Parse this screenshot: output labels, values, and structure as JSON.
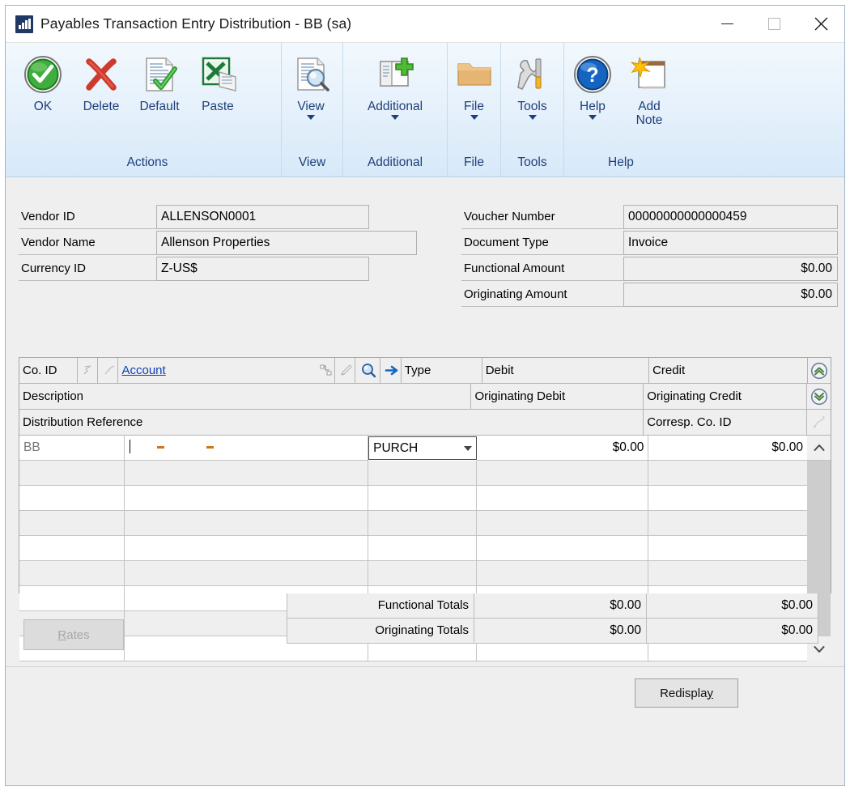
{
  "window": {
    "title": "Payables Transaction Entry Distribution  -  BB (sa)",
    "icon": "barchart-icon",
    "minimize_label": "Minimize",
    "maximize_label": "Maximize",
    "close_label": "Close"
  },
  "ribbon": {
    "groups": [
      {
        "name": "Actions",
        "label": "Actions",
        "buttons": [
          {
            "label": "OK",
            "icon": "green-check-circle-icon",
            "caret": false
          },
          {
            "label": "Delete",
            "icon": "red-x-icon",
            "caret": false
          },
          {
            "label": "Default",
            "icon": "document-check-icon",
            "caret": false
          },
          {
            "label": "Paste",
            "icon": "excel-paste-icon",
            "caret": false
          }
        ]
      },
      {
        "name": "View",
        "label": "View",
        "buttons": [
          {
            "label": "View",
            "icon": "document-magnifier-icon",
            "caret": true
          }
        ]
      },
      {
        "name": "Additional",
        "label": "Additional",
        "buttons": [
          {
            "label": "Additional",
            "icon": "window-plus-icon",
            "caret": true
          }
        ]
      },
      {
        "name": "File",
        "label": "File",
        "buttons": [
          {
            "label": "File",
            "icon": "folder-icon",
            "caret": true
          }
        ]
      },
      {
        "name": "Tools",
        "label": "Tools",
        "buttons": [
          {
            "label": "Tools",
            "icon": "wrench-screwdriver-icon",
            "caret": true
          }
        ]
      },
      {
        "name": "Help",
        "label": "Help",
        "buttons": [
          {
            "label": "Help",
            "icon": "blue-question-circle-icon",
            "caret": true
          },
          {
            "label": "Add\nNote",
            "label_line1": "Add",
            "label_line2": "Note",
            "icon": "note-star-icon",
            "caret": false
          }
        ]
      }
    ]
  },
  "form": {
    "left": [
      {
        "label": "Vendor ID",
        "value": "ALLENSON0001"
      },
      {
        "label": "Vendor Name",
        "value": "Allenson Properties"
      },
      {
        "label": "Currency ID",
        "value": "Z-US$"
      }
    ],
    "right": [
      {
        "label": "Voucher Number",
        "value": "00000000000000459",
        "align": "left"
      },
      {
        "label": "Document Type",
        "value": "Invoice",
        "align": "left"
      },
      {
        "label": "Functional Amount",
        "value": "$0.00",
        "align": "right"
      },
      {
        "label": "Originating Amount",
        "value": "$0.00",
        "align": "right"
      }
    ]
  },
  "grid": {
    "header": {
      "row1": {
        "co_id": "Co. ID",
        "account_link": "Account",
        "type": "Type",
        "debit": "Debit",
        "credit": "Credit"
      },
      "row2": {
        "description": "Description",
        "originating_debit": "Originating Debit",
        "originating_credit": "Originating Credit"
      },
      "row3": {
        "distribution_reference": "Distribution Reference",
        "corresp_co_id": "Corresp. Co. ID"
      },
      "icons": [
        "lookup-left-icon",
        "lookup-right-icon",
        "expand-tree-icon",
        "edit-pencil-icon",
        "magnifier-icon",
        "goto-arrow-icon",
        "scroll-to-top-icon",
        "scroll-to-bottom-icon",
        "grid-note-icon"
      ]
    },
    "rows": [
      {
        "co_id": "BB",
        "account": "-    -",
        "type": "PURCH",
        "debit": "$0.00",
        "credit": "$0.00",
        "active": true
      },
      {
        "co_id": "",
        "account": "",
        "type": "",
        "debit": "",
        "credit": ""
      },
      {
        "co_id": "",
        "account": "",
        "type": "",
        "debit": "",
        "credit": ""
      },
      {
        "co_id": "",
        "account": "",
        "type": "",
        "debit": "",
        "credit": ""
      },
      {
        "co_id": "",
        "account": "",
        "type": "",
        "debit": "",
        "credit": ""
      },
      {
        "co_id": "",
        "account": "",
        "type": "",
        "debit": "",
        "credit": ""
      },
      {
        "co_id": "",
        "account": "",
        "type": "",
        "debit": "",
        "credit": ""
      },
      {
        "co_id": "",
        "account": "",
        "type": "",
        "debit": "",
        "credit": ""
      },
      {
        "co_id": "",
        "account": "",
        "type": "",
        "debit": "",
        "credit": ""
      }
    ]
  },
  "totals": [
    {
      "label": "Functional Totals",
      "debit": "$0.00",
      "credit": "$0.00"
    },
    {
      "label": "Originating Totals",
      "debit": "$0.00",
      "credit": "$0.00"
    }
  ],
  "buttons": {
    "rates": {
      "label": "Rates",
      "accel": "R",
      "rest": "ates",
      "disabled": true
    },
    "redisplay": {
      "label": "Redisplay",
      "prefix": "Redispla",
      "accel": "y",
      "disabled": false
    }
  },
  "colors": {
    "ribbon_text": "#1f3f7a",
    "link": "#0b3fbd",
    "accent_green": "#33a03a",
    "accent_red": "#c0392b",
    "window_border": "#9ab4d0"
  }
}
